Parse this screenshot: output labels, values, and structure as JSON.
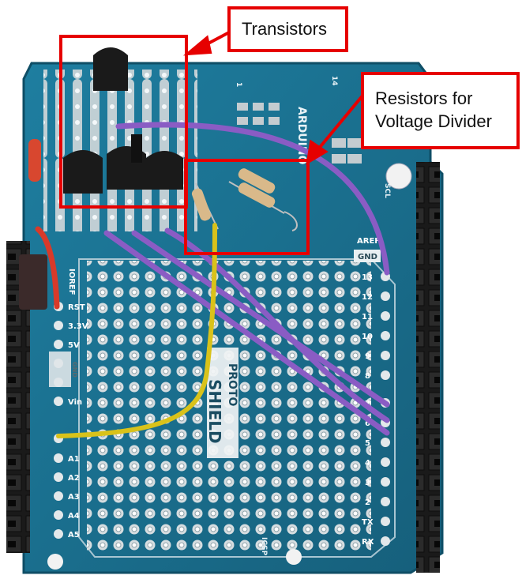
{
  "callouts": {
    "transistors": "Transistors",
    "resistors": "Resistors for Voltage Divider"
  },
  "board": {
    "brand_text": "ARDUINO",
    "proto_text": "PROTO",
    "shield_text": "SHIELD",
    "ioref": "IOREF",
    "rst": "RST",
    "v33": "3.3V",
    "v5": "5V",
    "gnd_left": "GND",
    "vin": "Vin",
    "a1": "A1",
    "a2": "A2",
    "a3": "A3",
    "a4": "A4",
    "a5": "A5",
    "aref": "AREF",
    "gnd_right": "GND",
    "d13": "13",
    "d12": "12",
    "d11": "11",
    "d10": "10",
    "d9": "9",
    "d8": "8",
    "d7": "7",
    "d6": "6",
    "d5": "5",
    "d4": "4",
    "d3": "3",
    "d2": "2",
    "tx": "TX",
    "rx": "RX",
    "top_14": "14",
    "top_1": "1",
    "scl": "SCL",
    "icsp": "ICSP"
  },
  "colors": {
    "callout_border": "#e60000",
    "board": "#1b6f8f",
    "wire_purple": "#8a5cc4",
    "wire_yellow": "#d9c21a",
    "wire_red": "#d83a2a",
    "header": "#1e1e1e"
  }
}
